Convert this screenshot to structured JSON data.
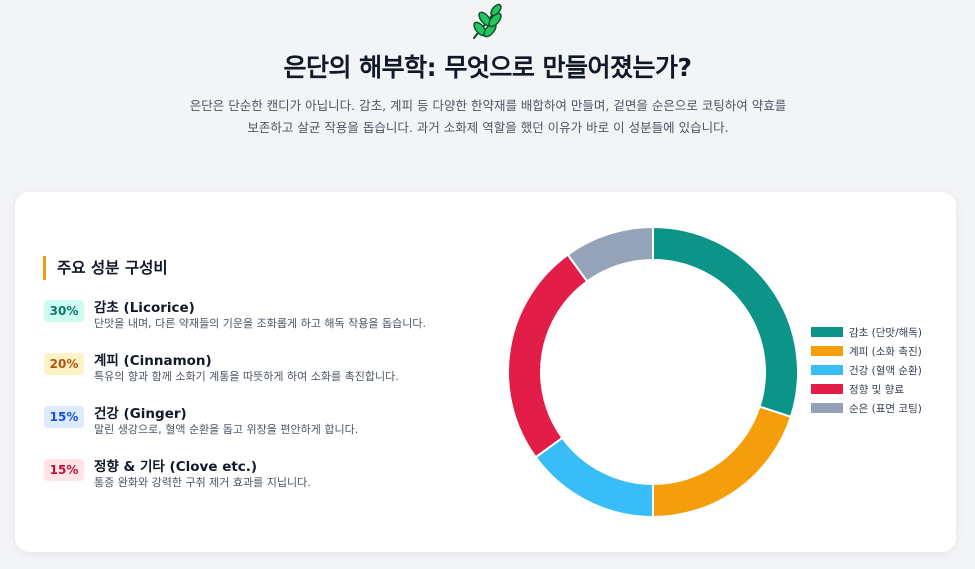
{
  "header": {
    "icon": "leaf-sprig-icon",
    "title": "은단의 해부학: 무엇으로 만들어졌는가?",
    "intro": "은단은 단순한 캔디가 아닙니다. 감초, 계피 등 다양한 한약재를 배합하여 만들며, 겉면을 순은으로 코팅하여 약효를 보존하고 살균 작용을 돕습니다. 과거 소화제 역할을 했던 이유가 바로 이 성분들에 있습니다."
  },
  "composition": {
    "heading": "주요 성분 구성비",
    "accent_color": "#f59e0b",
    "items": [
      {
        "percent": "30%",
        "name": "감초 (Licorice)",
        "desc": "단맛을 내며, 다른 약재들의 기운을 조화롭게 하고 해독 작용을 돕습니다.",
        "badge_bg": "#ccfbf1",
        "badge_fg": "#0f766e"
      },
      {
        "percent": "20%",
        "name": "계피 (Cinnamon)",
        "desc": "특유의 향과 함께 소화기 계통을 따뜻하게 하여 소화를 촉진합니다.",
        "badge_bg": "#fef3c7",
        "badge_fg": "#b45309"
      },
      {
        "percent": "15%",
        "name": "건강 (Ginger)",
        "desc": "말린 생강으로, 혈액 순환을 돕고 위장을 편안하게 합니다.",
        "badge_bg": "#dbeafe",
        "badge_fg": "#1d4ed8"
      },
      {
        "percent": "15%",
        "name": "정향 & 기타 (Clove etc.)",
        "desc": "통증 완화와 강력한 구취 제거 효과를 지닙니다.",
        "badge_bg": "#ffe4e6",
        "badge_fg": "#be123c"
      }
    ]
  },
  "chart_data": {
    "type": "pie",
    "donut": true,
    "categories": [
      "감초 (단맛/해독)",
      "계피 (소화 촉진)",
      "건강 (혈액 순환)",
      "정향 및 향료",
      "순은 (표면 코팅)"
    ],
    "values": [
      30,
      20,
      15,
      25,
      10
    ],
    "colors": [
      "#0d9488",
      "#f59e0b",
      "#38bdf8",
      "#e11d48",
      "#94a3b8"
    ],
    "legend": "right"
  }
}
